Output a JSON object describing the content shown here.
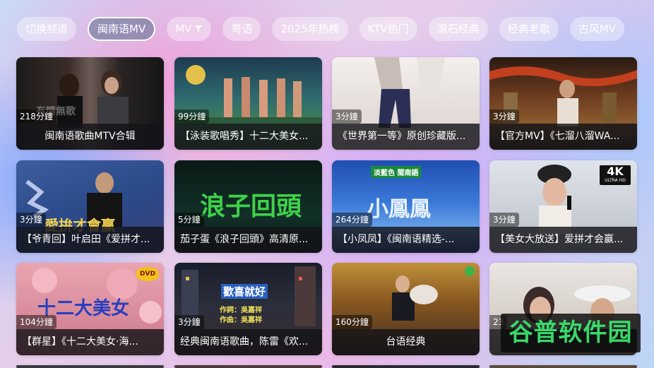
{
  "chips": [
    "切换频道",
    "闽南语MV",
    "MV",
    "粤语",
    "2025年热榜",
    "KTV热门",
    "滚石经典",
    "经典老歌",
    "古风MV"
  ],
  "chip_active_index": 1,
  "cards": [
    {
      "duration": "218分鐘",
      "title": "闽南语歌曲MTV合辑",
      "overlay": "有情無歌"
    },
    {
      "duration": "99分鐘",
      "title": "【泳装歌唱秀】十二大美女...",
      "overlay": ""
    },
    {
      "duration": "3分鐘",
      "title": "《世界第一等》原创珍藏版...",
      "overlay": ""
    },
    {
      "duration": "3分鐘",
      "title": "【官方MV】《七溜八溜WA...",
      "overlay": ""
    },
    {
      "duration": "3分鐘",
      "title": "【爷青回】叶启田《爱拼才...",
      "overlay": "愛拚才會赢"
    },
    {
      "duration": "5分鐘",
      "title": "茄子蛋《浪子回頭》高清原...",
      "overlay": "浪子回頭"
    },
    {
      "duration": "264分鐘",
      "title": "【小凤凤】《闽南语精选-...",
      "overlay": "小鳳鳳",
      "overlay2": "淡藍色 閩南語"
    },
    {
      "duration": "3分鐘",
      "title": "【美女大放送】爱拼才会赢...",
      "overlay": "",
      "badge": "4K",
      "badge_sub": "ULTRA HD"
    },
    {
      "duration": "104分鐘",
      "title": "【群星】《十二大美女·海...",
      "overlay": "十二大美女",
      "badge": "DVD"
    },
    {
      "duration": "3分鐘",
      "title": "经典闽南语歌曲，陈雷《欢...",
      "overlay": "歡喜就好",
      "overlay2": "作詞：吳嘉祥",
      "overlay3": "作曲：吳嘉祥"
    },
    {
      "duration": "160分鐘",
      "title": "台语经典",
      "overlay": ""
    },
    {
      "duration": "23",
      "title": "",
      "overlay": ""
    }
  ],
  "watermark": "谷普软件园",
  "colors": {
    "chip_text": "#ffffff",
    "caption_bg": "#141418",
    "watermark": "#39d96a"
  }
}
